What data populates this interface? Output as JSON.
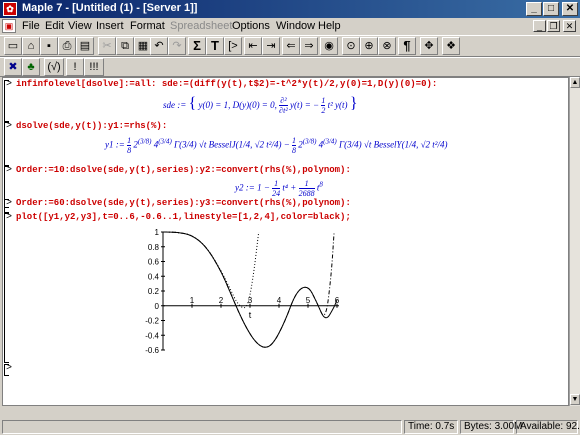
{
  "window": {
    "title": "Maple 7 - [Untitled (1) - [Server 1]]",
    "app_icon": "maple-leaf-icon",
    "controls": [
      "_",
      "□",
      "✕"
    ]
  },
  "menu": [
    "File",
    "Edit",
    "View",
    "Insert",
    "Format",
    "Spreadsheet",
    "Options",
    "Window",
    "Help"
  ],
  "menu_disabled": [
    "Spreadsheet"
  ],
  "toolbar1_icons": [
    "new-icon",
    "open-icon",
    "save-icon",
    "print-icon",
    "print-preview-icon",
    "cut-icon",
    "copy-icon",
    "paste-icon",
    "undo-icon",
    "redo-icon",
    "sigma-icon",
    "text-T-icon",
    "prompt-icon",
    "indent-left-icon",
    "indent-right-icon",
    "back-icon",
    "forward-icon",
    "stop-icon",
    "zoom-100-icon",
    "zoom-150-icon",
    "zoom-200-icon",
    "pilcrow-icon",
    "restart-icon",
    "help-book-icon"
  ],
  "toolbar1_glyphs": {
    "sigma": "Σ",
    "text": "T",
    "prompt": "[>",
    "pilcrow": "¶"
  },
  "toolbar2": {
    "glyphs": [
      "✖",
      "♣",
      "(√)",
      "!",
      "!!!"
    ]
  },
  "worksheet": {
    "commands": [
      "infinfolevel[dsolve]:=all: sde:=(diff(y(t),t$2)=-t^2*y(t)/2,y(0)=1,D(y)(0)=0):",
      "dsolve(sde,y(t)):y1:=rhs(%):",
      "Order:=10:dsolve(sde,y(t),series):y2:=convert(rhs(%),polynom):",
      "Order:=60:dsolve(sde,y(t),series):y3:=convert(rhs(%),polynom):",
      "plot([y1,y2,y3],t=0..6,-0.6..1,linestyle=[1,2,4],color=black);"
    ],
    "prompt": ">",
    "outputs": {
      "sde_lhs": "sde :=",
      "sde_body": "y(0) = 1, D(y)(0) = 0,",
      "sde_ode": "y(t) = −",
      "y1_lhs": "y1 :=",
      "y1_body": "Γ(3/4) √t BesselJ(1/4, √2 t²/4) − ",
      "y2_lhs": "y2 := 1 −",
      "y2_body": "t⁴ +",
      "y2_frac1_num": "1",
      "y2_frac1_den": "24",
      "y2_frac2_num": "1",
      "y2_frac2_den": "2688",
      "y2_pow": "8"
    }
  },
  "plot": {
    "t_label": "t",
    "x_ticks": [
      "1",
      "2",
      "3",
      "4",
      "5",
      "6"
    ],
    "y_ticks": [
      "1",
      "0.8",
      "0.6",
      "0.4",
      "0.2",
      "0",
      "-0.2",
      "-0.4",
      "-0.6"
    ]
  },
  "chart_data": {
    "type": "line",
    "xlabel": "t",
    "ylabel": "",
    "xlim": [
      0,
      6
    ],
    "ylim": [
      -0.6,
      1
    ],
    "series": [
      {
        "style": "solid",
        "x": [
          0,
          0.5,
          1,
          1.5,
          2,
          2.3,
          2.6,
          2.9,
          3.2,
          3.5,
          3.8,
          4.2,
          4.6,
          5.0,
          5.3,
          5.6,
          5.9,
          6.0
        ],
        "y": [
          1,
          0.997,
          0.96,
          0.8,
          0.47,
          0.2,
          -0.08,
          -0.32,
          -0.5,
          -0.58,
          -0.52,
          -0.22,
          0.2,
          0.28,
          0.05,
          -0.22,
          -0.02,
          0.08
        ]
      },
      {
        "style": "dotted",
        "x": [
          0,
          0.5,
          1,
          1.5,
          2,
          2.3,
          2.6,
          2.9,
          3.1,
          3.3
        ],
        "y": [
          1,
          0.997,
          0.96,
          0.8,
          0.48,
          0.24,
          0.0,
          -0.05,
          0.35,
          1.0
        ]
      },
      {
        "style": "dashdot",
        "x": [
          0,
          0.5,
          1,
          1.5,
          2,
          2.3,
          2.6,
          2.9,
          3.2,
          3.5,
          3.8,
          4.2,
          4.6,
          5.0,
          5.3,
          5.6,
          5.8,
          5.9
        ],
        "y": [
          1,
          0.997,
          0.96,
          0.8,
          0.47,
          0.2,
          -0.08,
          -0.32,
          -0.5,
          -0.58,
          -0.52,
          -0.22,
          0.2,
          0.28,
          0.05,
          -0.22,
          0.4,
          1.0
        ]
      }
    ]
  },
  "status": {
    "time": "Time:  0.7s",
    "bytes": "Bytes: 3.00M",
    "available": "Available: 92.3M"
  }
}
